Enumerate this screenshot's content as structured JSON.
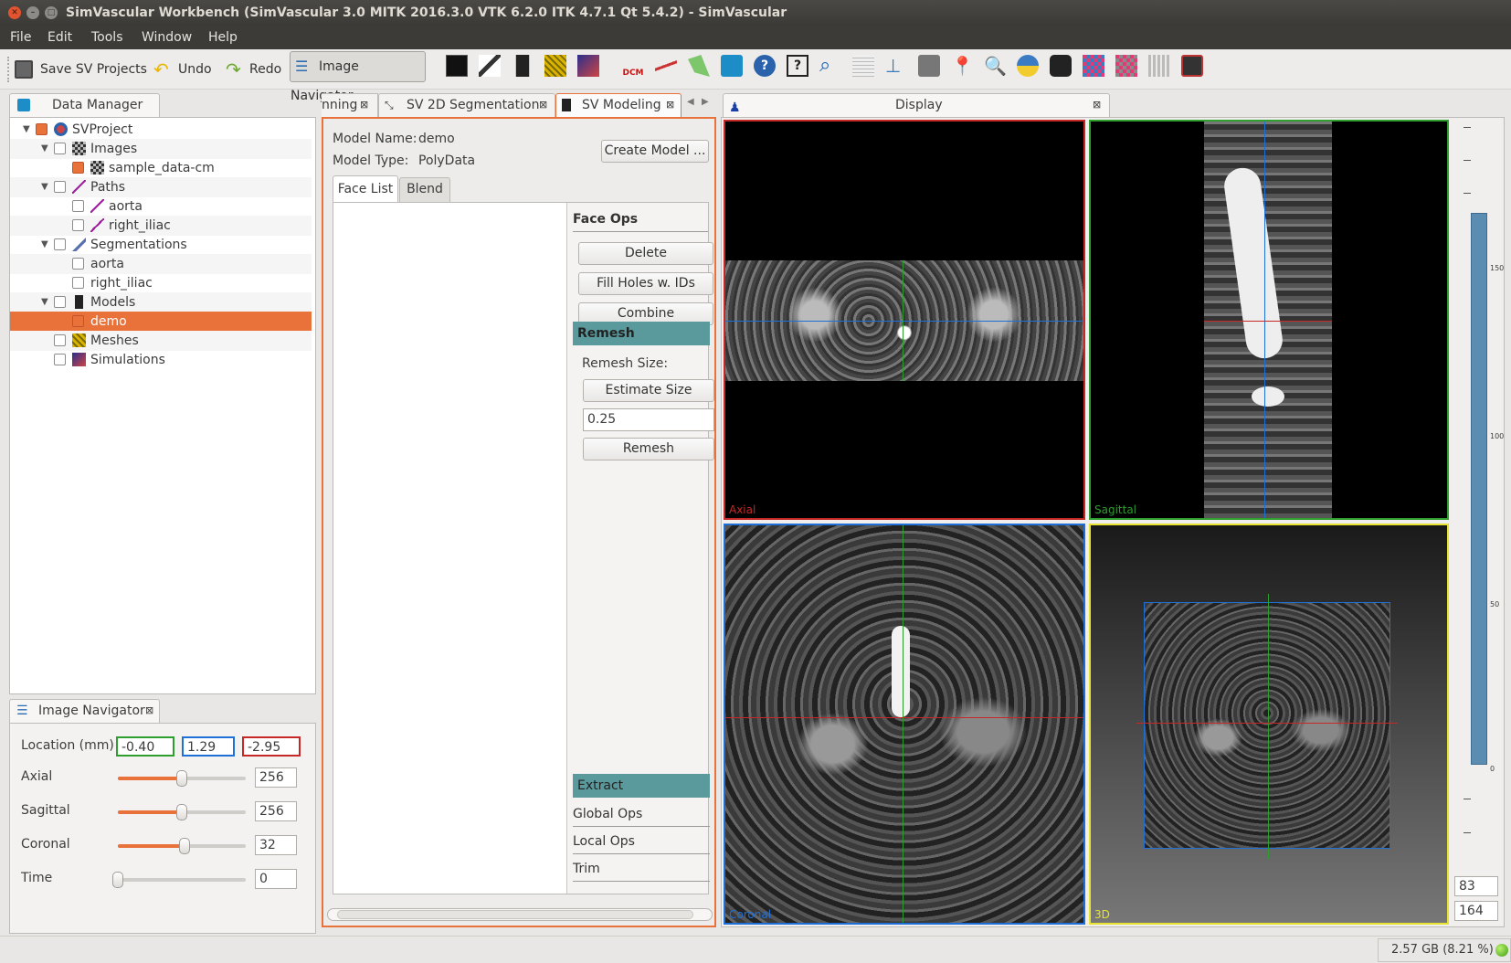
{
  "window": {
    "title": "SimVascular Workbench (SimVascular 3.0 MITK 2016.3.0 VTK 6.2.0 ITK 4.7.1 Qt 5.4.2) - SimVascular"
  },
  "menu": [
    "File",
    "Edit",
    "Tools",
    "Window",
    "Help"
  ],
  "toolbar": {
    "save": "Save SV Projects",
    "undo": "Undo",
    "redo": "Redo",
    "image_nav": "Image Navigator"
  },
  "data_manager": {
    "title": "Data Manager",
    "items": [
      {
        "label": "SVProject",
        "level": 0
      },
      {
        "label": "Images",
        "level": 1
      },
      {
        "label": "sample_data-cm",
        "level": 2
      },
      {
        "label": "Paths",
        "level": 1
      },
      {
        "label": "aorta",
        "level": 2
      },
      {
        "label": "right_iliac",
        "level": 2
      },
      {
        "label": "Segmentations",
        "level": 1
      },
      {
        "label": "aorta",
        "level": 2
      },
      {
        "label": "right_iliac",
        "level": 2
      },
      {
        "label": "Models",
        "level": 1
      },
      {
        "label": "demo",
        "level": 2
      },
      {
        "label": "Meshes",
        "level": 1
      },
      {
        "label": "Simulations",
        "level": 1
      }
    ]
  },
  "image_navigator": {
    "title": "Image Navigator",
    "location_label": "Location (mm)",
    "loc_x": "-0.40",
    "loc_y": "1.29",
    "loc_z": "-2.95",
    "axial_label": "Axial",
    "axial_val": "256",
    "axial_frac": 0.5,
    "sagittal_label": "Sagittal",
    "sagittal_val": "256",
    "sagittal_frac": 0.5,
    "coronal_label": "Coronal",
    "coronal_val": "32",
    "coronal_frac": 0.52,
    "time_label": "Time",
    "time_val": "0",
    "time_frac": 0
  },
  "tabs": {
    "t1": "nning",
    "t2": "SV 2D Segmentation",
    "t3": "SV Modeling"
  },
  "modeling": {
    "name_label": "Model Name:",
    "name_value": "demo",
    "type_label": "Model Type:",
    "type_value": "PolyData",
    "create_btn": "Create Model ...",
    "tab_face": "Face List",
    "tab_blend": "Blend",
    "face_ops": "Face Ops",
    "delete": "Delete",
    "fill": "Fill Holes w. IDs",
    "combine": "Combine",
    "remesh_header": "Remesh",
    "remesh_size_label": "Remesh Size:",
    "estimate": "Estimate Size",
    "remesh_value": "0.25",
    "remesh_btn": "Remesh",
    "extract": "Extract",
    "global_ops": "Global Ops",
    "local_ops": "Local Ops",
    "trim": "Trim"
  },
  "display": {
    "title": "Display",
    "axial": "Axial",
    "sagittal": "Sagittal",
    "coronal": "Coronal",
    "view3d": "3D",
    "level_top": "83",
    "level_bottom": "164",
    "scale_ticks": [
      "150",
      "100",
      "50",
      "0"
    ]
  },
  "status": {
    "memory": "2.57 GB (8.21 %)"
  },
  "colors": {
    "accent": "#e9713a",
    "axial": "#c62828",
    "sagittal": "#2e9e2e",
    "coronal": "#1e6fd8",
    "view3d": "#e8e231"
  }
}
